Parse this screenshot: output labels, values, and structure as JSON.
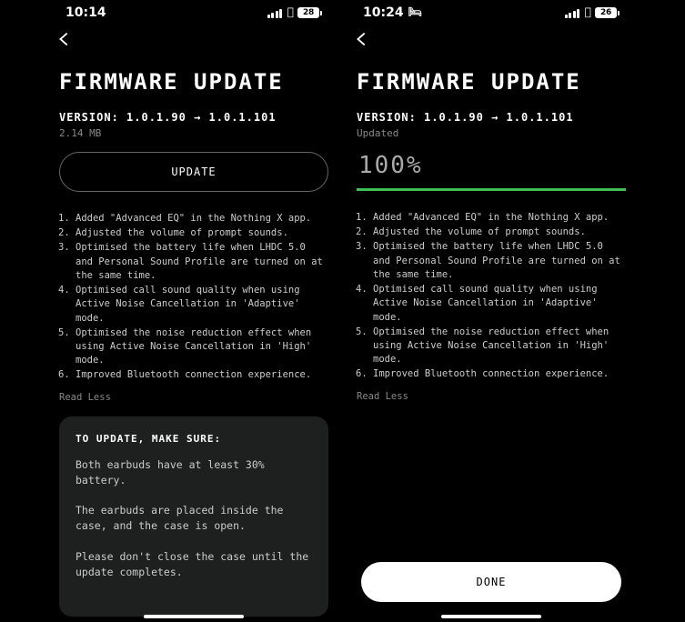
{
  "left": {
    "status": {
      "time": "10:14",
      "battery": "28"
    },
    "title": "FIRMWARE UPDATE",
    "version_label": "VERSION:",
    "version_from": "1.0.1.90",
    "version_arrow": "→",
    "version_to": "1.0.1.101",
    "size": "2.14 MB",
    "update_button": "UPDATE",
    "read_less": "Read Less",
    "notes": [
      "Added \"Advanced EQ\" in the Nothing X app.",
      "Adjusted the volume of prompt sounds.",
      "Optimised the battery life when LHDC 5.0 and Personal Sound Profile are turned on at the same time.",
      "Optimised call sound quality when using Active Noise Cancellation in 'Adaptive' mode.",
      "Optimised the noise reduction effect when using Active Noise Cancellation in 'High' mode.",
      "Improved Bluetooth connection experience."
    ],
    "instructions": {
      "heading": "TO UPDATE, MAKE SURE:",
      "lines": [
        "Both earbuds have at least 30% battery.",
        "The earbuds are placed inside the case, and the case is open.",
        "Please don't close the case until the update completes."
      ]
    }
  },
  "right": {
    "status": {
      "time": "10:24",
      "battery": "26"
    },
    "title": "FIRMWARE UPDATE",
    "version_label": "VERSION:",
    "version_from": "1.0.1.90",
    "version_arrow": "→",
    "version_to": "1.0.1.101",
    "status_text": "Updated",
    "percent": "100%",
    "progress_value": 100,
    "read_less": "Read Less",
    "done_button": "DONE",
    "notes": [
      "Added \"Advanced EQ\" in the Nothing X app.",
      "Adjusted the volume of prompt sounds.",
      "Optimised the battery life when LHDC 5.0 and Personal Sound Profile are turned on at the same time.",
      "Optimised call sound quality when using Active Noise Cancellation in 'Adaptive' mode.",
      "Optimised the noise reduction effect when using Active Noise Cancellation in 'High' mode.",
      "Improved Bluetooth connection experience."
    ]
  }
}
